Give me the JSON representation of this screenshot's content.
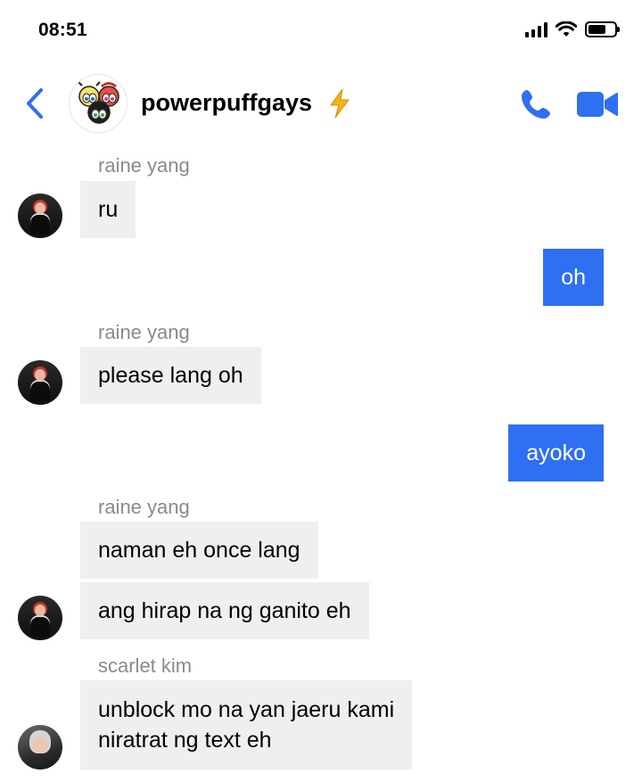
{
  "status_bar": {
    "time": "08:51"
  },
  "header": {
    "group_name": "powerpuffgays",
    "name_emoji": "⚡",
    "icons": [
      "back-chevron-icon",
      "phone-icon",
      "video-camera-icon"
    ],
    "accent_color": "#2f6ff1"
  },
  "messages": [
    {
      "sender": "raine yang",
      "text": "ru",
      "direction": "incoming"
    },
    {
      "text": "oh",
      "direction": "outgoing"
    },
    {
      "sender": "raine yang",
      "text": "please lang oh",
      "direction": "incoming"
    },
    {
      "text": "ayoko",
      "direction": "outgoing"
    },
    {
      "sender": "raine yang",
      "text": "naman eh once lang",
      "direction": "incoming"
    },
    {
      "text": "ang hirap na ng ganito eh",
      "direction": "incoming"
    },
    {
      "sender": "scarlet kim",
      "text_lines": [
        "unblock mo na yan jaeru kami",
        "niratrat ng text eh"
      ],
      "direction": "incoming"
    }
  ]
}
